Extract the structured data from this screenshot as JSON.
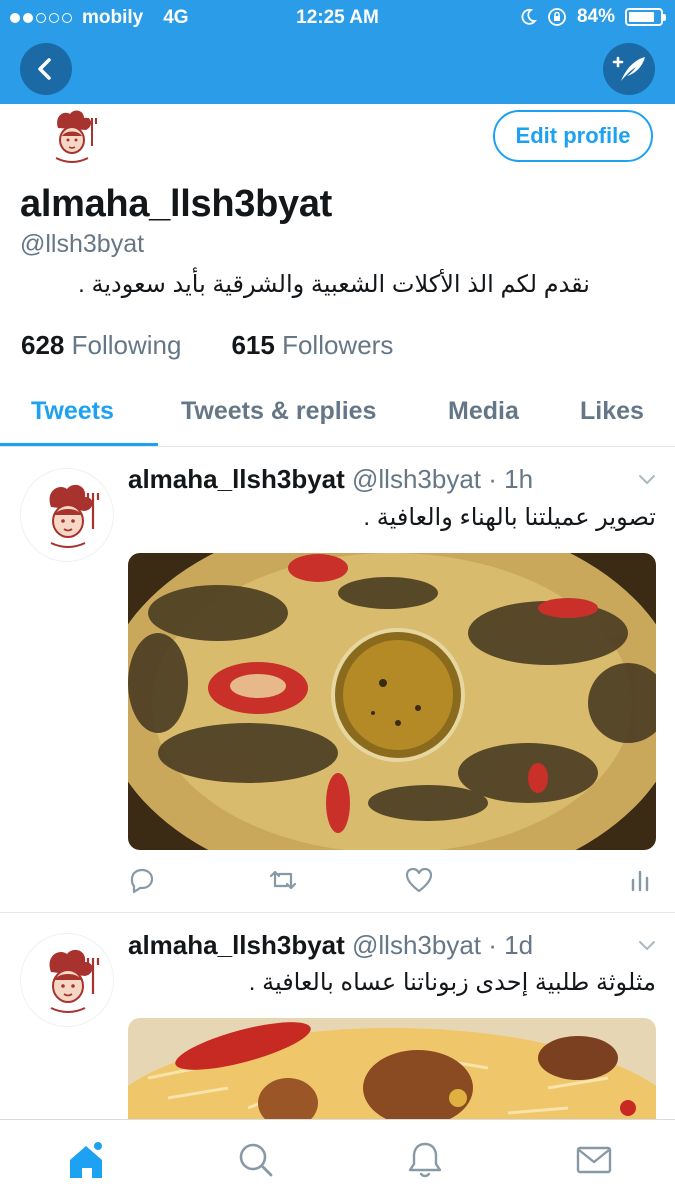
{
  "status_bar": {
    "carrier": "mobily",
    "network": "4G",
    "time": "12:25 AM",
    "battery": "84%",
    "battery_level": 0.84,
    "signal_dots_on": 2,
    "signal_dots_total": 5
  },
  "header": {
    "back_icon": "chevron-left-icon",
    "compose_icon": "compose-quill-icon",
    "bar_color": "#2b9ce8"
  },
  "profile": {
    "edit_label": "Edit profile",
    "display_name": "almaha_llsh3byat",
    "handle": "@llsh3byat",
    "bio": "نقدم لكم الذ الأكلات الشعبية والشرقية بأيد سعودية .",
    "following_count": "628",
    "following_label": "Following",
    "followers_count": "615",
    "followers_label": "Followers"
  },
  "tabs": [
    {
      "label": "Tweets",
      "active": true
    },
    {
      "label": "Tweets & replies",
      "active": false
    },
    {
      "label": "Media",
      "active": false
    },
    {
      "label": "Likes",
      "active": false
    }
  ],
  "tweets": [
    {
      "name": "almaha_llsh3byat",
      "meta": "@llsh3byat · 1h",
      "text": "تصوير عميلتنا بالهناء والعافية ."
    },
    {
      "name": "almaha_llsh3byat",
      "meta": "@llsh3byat · 1d",
      "text": "مثلوثة طلبية إحدى زبوناتنا عساه بالعافية ."
    }
  ],
  "colors": {
    "accent": "#1da1f2",
    "muted": "#657786",
    "text": "#14171a"
  }
}
